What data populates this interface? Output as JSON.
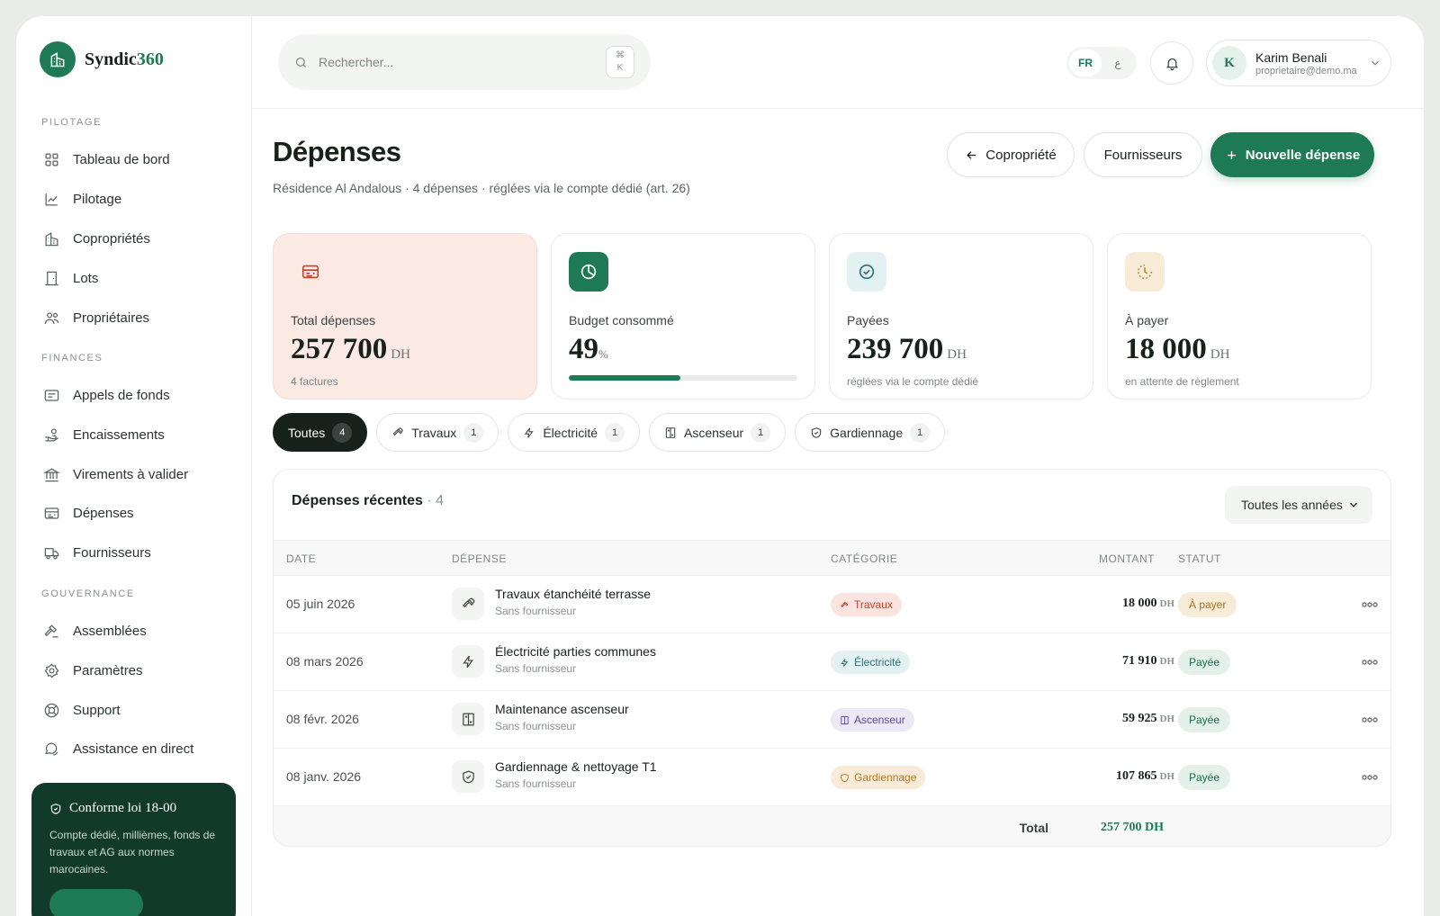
{
  "brand": {
    "name_main": "Syndic",
    "name_accent": "360"
  },
  "sidebar": {
    "sections": [
      {
        "title": "PILOTAGE",
        "items": [
          {
            "label": "Tableau de bord",
            "icon": "grid-icon"
          },
          {
            "label": "Pilotage",
            "icon": "chart-line-icon"
          },
          {
            "label": "Copropriétés",
            "icon": "building-icon"
          },
          {
            "label": "Lots",
            "icon": "door-icon"
          },
          {
            "label": "Propriétaires",
            "icon": "users-icon"
          }
        ]
      },
      {
        "title": "FINANCES",
        "items": [
          {
            "label": "Appels de fonds",
            "icon": "invoice-icon"
          },
          {
            "label": "Encaissements",
            "icon": "hand-coins-icon"
          },
          {
            "label": "Virements à valider",
            "icon": "bank-icon"
          },
          {
            "label": "Dépenses",
            "icon": "receipt-icon"
          },
          {
            "label": "Fournisseurs",
            "icon": "truck-icon"
          }
        ]
      },
      {
        "title": "GOUVERNANCE",
        "items": [
          {
            "label": "Assemblées",
            "icon": "gavel-icon"
          },
          {
            "label": "Paramètres",
            "icon": "gear-icon"
          },
          {
            "label": "Support",
            "icon": "lifebuoy-icon"
          },
          {
            "label": "Assistance en direct",
            "icon": "chat-icon"
          }
        ]
      }
    ],
    "promo": {
      "title": "Conforme loi 18-00",
      "text": "Compte dédié, millièmes, fonds de travaux et AG aux normes marocaines."
    }
  },
  "topbar": {
    "search_placeholder": "Rechercher...",
    "shortcut_symbol": "⌘",
    "shortcut_key": "K",
    "lang_active": "FR",
    "lang_other": "ع",
    "user": {
      "initial": "K",
      "name": "Karim Benali",
      "email": "proprietaire@demo.ma"
    }
  },
  "page": {
    "title": "Dépenses",
    "subtitle": "Résidence Al Andalous · 4 dépenses · réglées via le compte dédié (art. 26)",
    "buttons": {
      "back": "Copropriété",
      "suppliers": "Fournisseurs",
      "new": "Nouvelle dépense"
    }
  },
  "stats": [
    {
      "label": "Total dépenses",
      "value": "257 700",
      "unit": "DH",
      "note": "4 factures",
      "color": "#c2412d"
    },
    {
      "label": "Budget consommé",
      "value": "49",
      "unit": "%",
      "progress": 0.49,
      "color": "#1e7a55"
    },
    {
      "label": "Payées",
      "value": "239 700",
      "unit": "DH",
      "note": "réglées via le compte dédié",
      "color": "#2f6e7a"
    },
    {
      "label": "À payer",
      "value": "18 000",
      "unit": "DH",
      "note": "en attente de règlement",
      "color": "#c08a2c"
    }
  ],
  "filters": [
    {
      "label": "Toutes",
      "count": "4",
      "active": true
    },
    {
      "label": "Travaux",
      "count": "1",
      "icon": "hammer-icon"
    },
    {
      "label": "Électricité",
      "count": "1",
      "icon": "bolt-icon"
    },
    {
      "label": "Ascenseur",
      "count": "1",
      "icon": "elevator-icon"
    },
    {
      "label": "Gardiennage",
      "count": "1",
      "icon": "shield-icon"
    }
  ],
  "table": {
    "title": "Dépenses récentes",
    "count": "· 4",
    "year_filter": "Toutes les années",
    "columns": {
      "date": "DATE",
      "expense": "DÉPENSE",
      "category": "CATÉGORIE",
      "amount": "MONTANT",
      "status": "STATUT"
    },
    "rows": [
      {
        "date": "05 juin 2026",
        "name": "Travaux étanchéité terrasse",
        "supplier": "Sans fournisseur",
        "category": "Travaux",
        "amount": "18 000",
        "unit": "DH",
        "status": "À payer",
        "icon": "hammer-icon"
      },
      {
        "date": "08 mars 2026",
        "name": "Électricité parties communes",
        "supplier": "Sans fournisseur",
        "category": "Électricité",
        "amount": "71 910",
        "unit": "DH",
        "status": "Payée",
        "icon": "bolt-icon"
      },
      {
        "date": "08 févr. 2026",
        "name": "Maintenance ascenseur",
        "supplier": "Sans fournisseur",
        "category": "Ascenseur",
        "amount": "59 925",
        "unit": "DH",
        "status": "Payée",
        "icon": "elevator-icon"
      },
      {
        "date": "08 janv. 2026",
        "name": "Gardiennage & nettoyage T1",
        "supplier": "Sans fournisseur",
        "category": "Gardiennage",
        "amount": "107 865",
        "unit": "DH",
        "status": "Payée",
        "icon": "shield-icon"
      }
    ],
    "total_label": "Total",
    "total_value": "257 700 DH"
  },
  "colors": {
    "accent": "#1e7a55",
    "travaux_bg": "#fbe4df",
    "travaux_fg": "#c2412d",
    "electricite_bg": "#e3f1f3",
    "electricite_fg": "#2f6e7a",
    "ascenseur_bg": "#ece8f6",
    "ascenseur_fg": "#5c4d94",
    "gardiennage_bg": "#f8ecd9",
    "gardiennage_fg": "#b07a22",
    "apayer_bg": "#f8ecd9",
    "apayer_fg": "#a8701c",
    "payee_bg": "#e3f1ea",
    "payee_fg": "#1e6b4a"
  }
}
